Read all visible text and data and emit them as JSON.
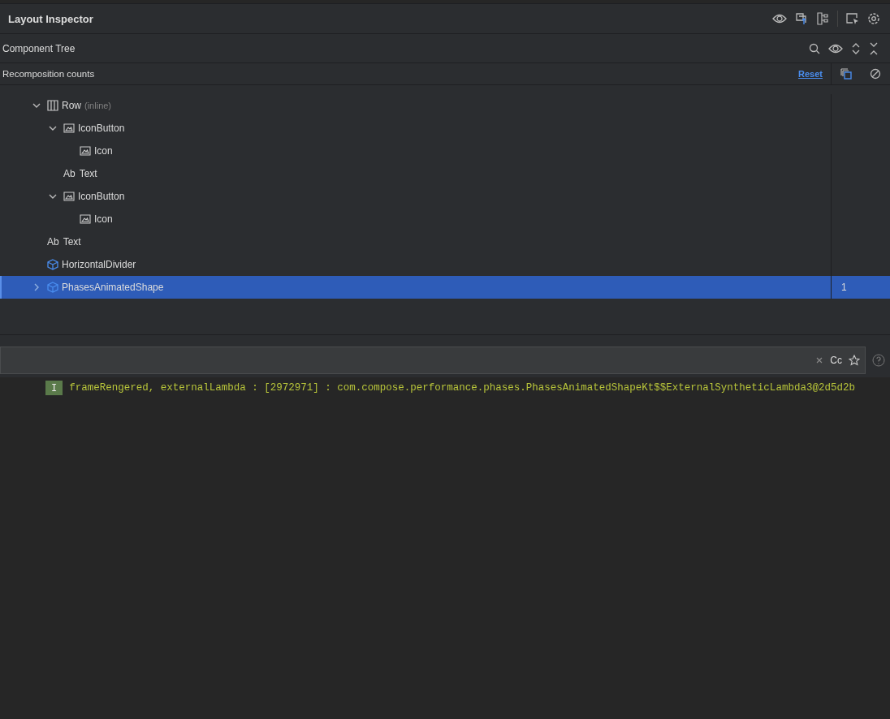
{
  "window": {
    "title": "Layout Inspector"
  },
  "component_tree": {
    "title": "Component Tree"
  },
  "recomposition": {
    "title": "Recomposition counts",
    "reset_link": "Reset"
  },
  "tree": [
    {
      "name": "Row",
      "detail": "(inline)",
      "kind": "row",
      "expanded": true,
      "selected": false,
      "children": [
        {
          "name": "IconButton",
          "kind": "image",
          "expanded": true,
          "selected": false,
          "children": [
            {
              "name": "Icon",
              "kind": "image",
              "selected": false
            }
          ]
        },
        {
          "name": "Text",
          "kind": "text",
          "type_label": "Ab",
          "selected": false
        },
        {
          "name": "IconButton",
          "kind": "image",
          "expanded": true,
          "selected": false,
          "children": [
            {
              "name": "Icon",
              "kind": "image",
              "selected": false
            }
          ]
        }
      ]
    },
    {
      "name": "Text",
      "kind": "text",
      "type_label": "Ab",
      "selected": false
    },
    {
      "name": "HorizontalDivider",
      "kind": "composable",
      "selected": false
    },
    {
      "name": "PhasesAnimatedShape",
      "kind": "composable",
      "expanded": false,
      "selected": true,
      "count": "1"
    }
  ],
  "logcat": {
    "filter_icon_text": "Cc",
    "lines": [
      {
        "level": "I",
        "message": "frameRengered, externalLambda : [2972971] : com.compose.performance.phases.PhasesAnimatedShapeKt$$ExternalSyntheticLambda3@2d5d2b"
      }
    ]
  }
}
